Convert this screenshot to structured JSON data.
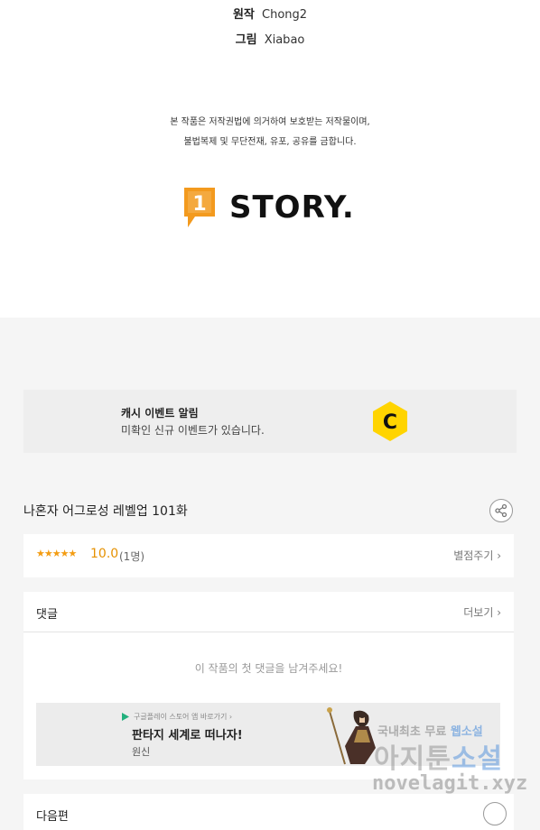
{
  "credits": {
    "original_label": "원작",
    "original_value": "Chong2",
    "art_label": "그림",
    "art_value": "Xiabao"
  },
  "copyright_notice": {
    "line1": "본 작품은 저작권법에 의거하여 보호받는 저작물이며,",
    "line2": "불법복제 및 무단전재, 유포, 공유를 금합니다."
  },
  "logo": {
    "badge_text": "1",
    "wordmark": "STORY."
  },
  "promo_banner": {
    "title": "캐시 이벤트 알림",
    "subtitle": "미확인 신규 이벤트가 있습니다.",
    "icon_letter": "C"
  },
  "episode": {
    "title": "나혼자 어그로성 레벨업 101화"
  },
  "rating": {
    "stars": "★★★★★",
    "score": "10.0",
    "count": "(1명)",
    "rate_button": "별점주기 ›"
  },
  "comments": {
    "header": "댓글",
    "more_button": "더보기 ›",
    "empty_message": "이 작품의 첫 댓글을 남겨주세요!"
  },
  "ad": {
    "tag": "구글플레이 스토어 앱 바로가기 ›",
    "title": "판타지 세계로 떠나자!",
    "subtitle": "원신"
  },
  "next_episode": {
    "label": "다음편"
  },
  "watermark": {
    "line1_a": "국내최초 무료 ",
    "line1_b": "웹소설",
    "line2_a": "아지툰",
    "line2_b": "소설",
    "line3": "novelagit.xyz"
  },
  "colors": {
    "accent_orange": "#f39c12",
    "promo_icon_yellow": "#ffd400",
    "logo_orange": "#f39a1e"
  }
}
